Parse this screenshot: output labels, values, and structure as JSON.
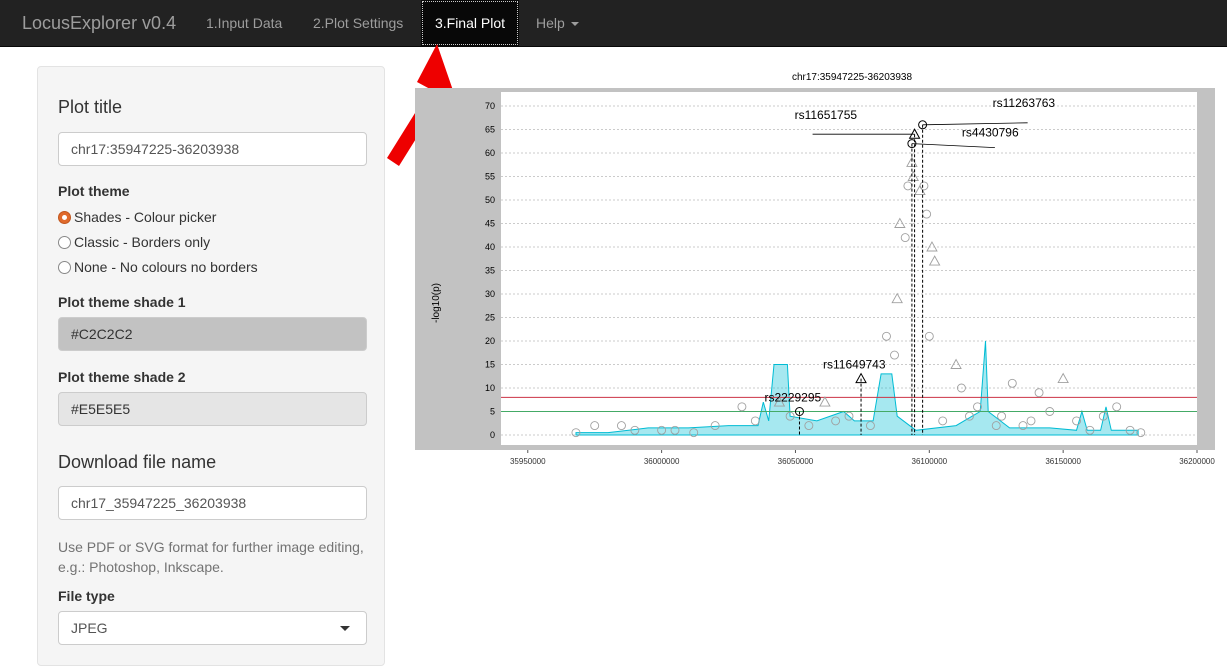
{
  "navbar": {
    "brand": "LocusExplorer v0.4",
    "tabs": [
      {
        "label": "1.Input Data"
      },
      {
        "label": "2.Plot Settings"
      },
      {
        "label": "3.Final Plot"
      },
      {
        "label": "Help"
      }
    ]
  },
  "sidebar": {
    "plot_title_heading": "Plot title",
    "plot_title_value": "chr17:35947225-36203938",
    "plot_theme_label": "Plot theme",
    "theme_options": [
      {
        "label": "Shades - Colour picker",
        "checked": true
      },
      {
        "label": "Classic - Borders only",
        "checked": false
      },
      {
        "label": "None - No colours no borders",
        "checked": false
      }
    ],
    "shade1_label": "Plot theme shade 1",
    "shade1_value": "#C2C2C2",
    "shade2_label": "Plot theme shade 2",
    "shade2_value": "#E5E5E5",
    "download_heading": "Download file name",
    "download_value": "chr17_35947225_36203938",
    "download_help": "Use PDF or SVG format for further image editing, e.g.: Photoshop, Inkscape.",
    "file_type_label": "File type",
    "file_type_value": "JPEG"
  },
  "colors": {
    "navbar_bg": "#222222",
    "shade1": "#C2C2C2",
    "shade2": "#E5E5E5",
    "annotation_arrow": "#ee0000",
    "recomb_fill": "#00bcd4",
    "sig_line": "#cc3344",
    "sugg_line": "#44aa66"
  },
  "chart_data": {
    "type": "scatter",
    "title": "chr17:35947225-36203938",
    "ylabel": "-log10(p)",
    "xlim": [
      35940000,
      36200000
    ],
    "ylim": [
      0,
      70
    ],
    "x_ticks": [
      "35950000",
      "36000000",
      "36050000",
      "36100000",
      "36150000",
      "36200000"
    ],
    "y_ticks": [
      "0",
      "5",
      "10",
      "15",
      "20",
      "25",
      "30",
      "35",
      "40",
      "45",
      "50",
      "55",
      "60",
      "65",
      "70"
    ],
    "hlines": [
      {
        "y": 8,
        "color": "#cc3344"
      },
      {
        "y": 5,
        "color": "#44aa66"
      }
    ],
    "labelled_snps": [
      {
        "label": "rs11263763",
        "x": 36097500,
        "y": 66,
        "shape": "circle"
      },
      {
        "label": "rs11651755",
        "x": 36094500,
        "y": 64,
        "shape": "triangle"
      },
      {
        "label": "rs4430796",
        "x": 36093500,
        "y": 62,
        "shape": "circle"
      },
      {
        "label": "rs11649743",
        "x": 36074500,
        "y": 12,
        "shape": "triangle"
      },
      {
        "label": "rs2229295",
        "x": 36051500,
        "y": 5,
        "shape": "circle"
      }
    ],
    "recombination_series": [
      {
        "x": 35968000,
        "y": 0.5
      },
      {
        "x": 35980000,
        "y": 0.5
      },
      {
        "x": 35995000,
        "y": 1.5
      },
      {
        "x": 36010000,
        "y": 1.5
      },
      {
        "x": 36025000,
        "y": 2
      },
      {
        "x": 36036000,
        "y": 2
      },
      {
        "x": 36038000,
        "y": 7
      },
      {
        "x": 36040000,
        "y": 3
      },
      {
        "x": 36042000,
        "y": 15
      },
      {
        "x": 36047000,
        "y": 15
      },
      {
        "x": 36048000,
        "y": 4
      },
      {
        "x": 36058000,
        "y": 3
      },
      {
        "x": 36068000,
        "y": 5
      },
      {
        "x": 36072000,
        "y": 3
      },
      {
        "x": 36079000,
        "y": 3
      },
      {
        "x": 36082000,
        "y": 13
      },
      {
        "x": 36086000,
        "y": 13
      },
      {
        "x": 36088000,
        "y": 4
      },
      {
        "x": 36095000,
        "y": 1
      },
      {
        "x": 36110000,
        "y": 2
      },
      {
        "x": 36116000,
        "y": 4
      },
      {
        "x": 36119000,
        "y": 5
      },
      {
        "x": 36121000,
        "y": 20
      },
      {
        "x": 36122000,
        "y": 5
      },
      {
        "x": 36130000,
        "y": 1.5
      },
      {
        "x": 36145000,
        "y": 1.5
      },
      {
        "x": 36155000,
        "y": 1
      },
      {
        "x": 36157000,
        "y": 5
      },
      {
        "x": 36159000,
        "y": 1
      },
      {
        "x": 36164000,
        "y": 1
      },
      {
        "x": 36166000,
        "y": 6
      },
      {
        "x": 36168000,
        "y": 1
      },
      {
        "x": 36178000,
        "y": 1
      }
    ],
    "other_points": [
      {
        "x": 36089000,
        "y": 45,
        "shape": "triangle"
      },
      {
        "x": 36091000,
        "y": 42,
        "shape": "circle"
      },
      {
        "x": 36092000,
        "y": 53,
        "shape": "circle"
      },
      {
        "x": 36093500,
        "y": 58,
        "shape": "triangle"
      },
      {
        "x": 36094000,
        "y": 55,
        "shape": "triangle"
      },
      {
        "x": 36096500,
        "y": 52,
        "shape": "triangle"
      },
      {
        "x": 36098000,
        "y": 53,
        "shape": "circle"
      },
      {
        "x": 36099000,
        "y": 47,
        "shape": "circle"
      },
      {
        "x": 36101000,
        "y": 40,
        "shape": "triangle"
      },
      {
        "x": 36102000,
        "y": 37,
        "shape": "triangle"
      },
      {
        "x": 36088000,
        "y": 29,
        "shape": "triangle"
      },
      {
        "x": 36084000,
        "y": 21,
        "shape": "circle"
      },
      {
        "x": 36100000,
        "y": 21,
        "shape": "circle"
      },
      {
        "x": 36087000,
        "y": 17,
        "shape": "circle"
      },
      {
        "x": 36110000,
        "y": 15,
        "shape": "triangle"
      },
      {
        "x": 36150000,
        "y": 12,
        "shape": "triangle"
      },
      {
        "x": 36131000,
        "y": 11,
        "shape": "circle"
      },
      {
        "x": 36112000,
        "y": 10,
        "shape": "circle"
      },
      {
        "x": 36141000,
        "y": 9,
        "shape": "circle"
      },
      {
        "x": 36044000,
        "y": 7,
        "shape": "triangle"
      },
      {
        "x": 36061000,
        "y": 7,
        "shape": "triangle"
      },
      {
        "x": 36030000,
        "y": 6,
        "shape": "circle"
      },
      {
        "x": 36118000,
        "y": 6,
        "shape": "circle"
      },
      {
        "x": 36170000,
        "y": 6,
        "shape": "circle"
      },
      {
        "x": 36145000,
        "y": 5,
        "shape": "circle"
      },
      {
        "x": 35975000,
        "y": 2,
        "shape": "circle"
      },
      {
        "x": 35990000,
        "y": 1,
        "shape": "circle"
      },
      {
        "x": 36005000,
        "y": 1,
        "shape": "circle"
      },
      {
        "x": 36020000,
        "y": 2,
        "shape": "circle"
      },
      {
        "x": 36035000,
        "y": 3,
        "shape": "circle"
      },
      {
        "x": 36055000,
        "y": 2,
        "shape": "circle"
      },
      {
        "x": 36065000,
        "y": 3,
        "shape": "circle"
      },
      {
        "x": 36078000,
        "y": 2,
        "shape": "circle"
      },
      {
        "x": 36105000,
        "y": 3,
        "shape": "circle"
      },
      {
        "x": 36125000,
        "y": 2,
        "shape": "circle"
      },
      {
        "x": 36135000,
        "y": 2,
        "shape": "circle"
      },
      {
        "x": 36160000,
        "y": 1,
        "shape": "circle"
      },
      {
        "x": 36175000,
        "y": 1,
        "shape": "circle"
      },
      {
        "x": 36000000,
        "y": 1,
        "shape": "circle"
      },
      {
        "x": 36012000,
        "y": 0.5,
        "shape": "circle"
      },
      {
        "x": 36048000,
        "y": 4,
        "shape": "circle"
      },
      {
        "x": 36070000,
        "y": 4,
        "shape": "circle"
      },
      {
        "x": 36115000,
        "y": 4,
        "shape": "circle"
      },
      {
        "x": 36127000,
        "y": 4,
        "shape": "circle"
      },
      {
        "x": 36138000,
        "y": 3,
        "shape": "circle"
      },
      {
        "x": 36155000,
        "y": 3,
        "shape": "circle"
      },
      {
        "x": 36165000,
        "y": 4,
        "shape": "circle"
      },
      {
        "x": 36179000,
        "y": 0.5,
        "shape": "circle"
      },
      {
        "x": 35968000,
        "y": 0.5,
        "shape": "circle"
      },
      {
        "x": 35985000,
        "y": 2,
        "shape": "circle"
      }
    ]
  }
}
